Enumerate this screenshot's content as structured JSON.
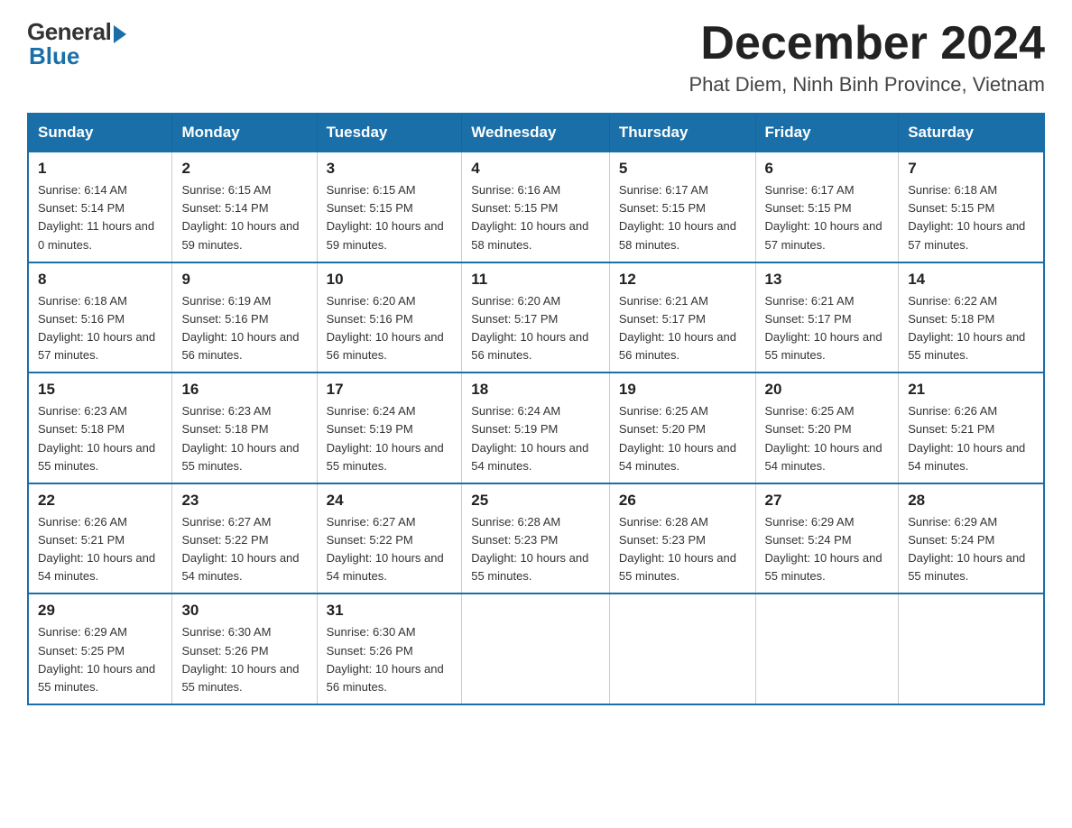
{
  "logo": {
    "general": "General",
    "blue": "Blue"
  },
  "title": {
    "month_year": "December 2024",
    "location": "Phat Diem, Ninh Binh Province, Vietnam"
  },
  "headers": [
    "Sunday",
    "Monday",
    "Tuesday",
    "Wednesday",
    "Thursday",
    "Friday",
    "Saturday"
  ],
  "weeks": [
    [
      {
        "day": "1",
        "sunrise": "6:14 AM",
        "sunset": "5:14 PM",
        "daylight": "11 hours and 0 minutes."
      },
      {
        "day": "2",
        "sunrise": "6:15 AM",
        "sunset": "5:14 PM",
        "daylight": "10 hours and 59 minutes."
      },
      {
        "day": "3",
        "sunrise": "6:15 AM",
        "sunset": "5:15 PM",
        "daylight": "10 hours and 59 minutes."
      },
      {
        "day": "4",
        "sunrise": "6:16 AM",
        "sunset": "5:15 PM",
        "daylight": "10 hours and 58 minutes."
      },
      {
        "day": "5",
        "sunrise": "6:17 AM",
        "sunset": "5:15 PM",
        "daylight": "10 hours and 58 minutes."
      },
      {
        "day": "6",
        "sunrise": "6:17 AM",
        "sunset": "5:15 PM",
        "daylight": "10 hours and 57 minutes."
      },
      {
        "day": "7",
        "sunrise": "6:18 AM",
        "sunset": "5:15 PM",
        "daylight": "10 hours and 57 minutes."
      }
    ],
    [
      {
        "day": "8",
        "sunrise": "6:18 AM",
        "sunset": "5:16 PM",
        "daylight": "10 hours and 57 minutes."
      },
      {
        "day": "9",
        "sunrise": "6:19 AM",
        "sunset": "5:16 PM",
        "daylight": "10 hours and 56 minutes."
      },
      {
        "day": "10",
        "sunrise": "6:20 AM",
        "sunset": "5:16 PM",
        "daylight": "10 hours and 56 minutes."
      },
      {
        "day": "11",
        "sunrise": "6:20 AM",
        "sunset": "5:17 PM",
        "daylight": "10 hours and 56 minutes."
      },
      {
        "day": "12",
        "sunrise": "6:21 AM",
        "sunset": "5:17 PM",
        "daylight": "10 hours and 56 minutes."
      },
      {
        "day": "13",
        "sunrise": "6:21 AM",
        "sunset": "5:17 PM",
        "daylight": "10 hours and 55 minutes."
      },
      {
        "day": "14",
        "sunrise": "6:22 AM",
        "sunset": "5:18 PM",
        "daylight": "10 hours and 55 minutes."
      }
    ],
    [
      {
        "day": "15",
        "sunrise": "6:23 AM",
        "sunset": "5:18 PM",
        "daylight": "10 hours and 55 minutes."
      },
      {
        "day": "16",
        "sunrise": "6:23 AM",
        "sunset": "5:18 PM",
        "daylight": "10 hours and 55 minutes."
      },
      {
        "day": "17",
        "sunrise": "6:24 AM",
        "sunset": "5:19 PM",
        "daylight": "10 hours and 55 minutes."
      },
      {
        "day": "18",
        "sunrise": "6:24 AM",
        "sunset": "5:19 PM",
        "daylight": "10 hours and 54 minutes."
      },
      {
        "day": "19",
        "sunrise": "6:25 AM",
        "sunset": "5:20 PM",
        "daylight": "10 hours and 54 minutes."
      },
      {
        "day": "20",
        "sunrise": "6:25 AM",
        "sunset": "5:20 PM",
        "daylight": "10 hours and 54 minutes."
      },
      {
        "day": "21",
        "sunrise": "6:26 AM",
        "sunset": "5:21 PM",
        "daylight": "10 hours and 54 minutes."
      }
    ],
    [
      {
        "day": "22",
        "sunrise": "6:26 AM",
        "sunset": "5:21 PM",
        "daylight": "10 hours and 54 minutes."
      },
      {
        "day": "23",
        "sunrise": "6:27 AM",
        "sunset": "5:22 PM",
        "daylight": "10 hours and 54 minutes."
      },
      {
        "day": "24",
        "sunrise": "6:27 AM",
        "sunset": "5:22 PM",
        "daylight": "10 hours and 54 minutes."
      },
      {
        "day": "25",
        "sunrise": "6:28 AM",
        "sunset": "5:23 PM",
        "daylight": "10 hours and 55 minutes."
      },
      {
        "day": "26",
        "sunrise": "6:28 AM",
        "sunset": "5:23 PM",
        "daylight": "10 hours and 55 minutes."
      },
      {
        "day": "27",
        "sunrise": "6:29 AM",
        "sunset": "5:24 PM",
        "daylight": "10 hours and 55 minutes."
      },
      {
        "day": "28",
        "sunrise": "6:29 AM",
        "sunset": "5:24 PM",
        "daylight": "10 hours and 55 minutes."
      }
    ],
    [
      {
        "day": "29",
        "sunrise": "6:29 AM",
        "sunset": "5:25 PM",
        "daylight": "10 hours and 55 minutes."
      },
      {
        "day": "30",
        "sunrise": "6:30 AM",
        "sunset": "5:26 PM",
        "daylight": "10 hours and 55 minutes."
      },
      {
        "day": "31",
        "sunrise": "6:30 AM",
        "sunset": "5:26 PM",
        "daylight": "10 hours and 56 minutes."
      },
      null,
      null,
      null,
      null
    ]
  ]
}
